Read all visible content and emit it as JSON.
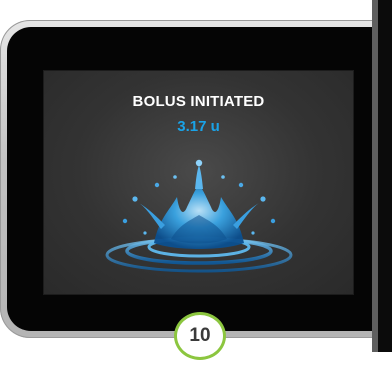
{
  "screen": {
    "title": "BOLUS INITIATED",
    "value": "3.17 u"
  },
  "step_badge": {
    "number": "10"
  },
  "icons": {
    "splash": "water-splash-icon"
  },
  "colors": {
    "value_text": "#1aa3e8",
    "badge_border": "#8cc63f",
    "screen_background": "#3a3a3a"
  }
}
